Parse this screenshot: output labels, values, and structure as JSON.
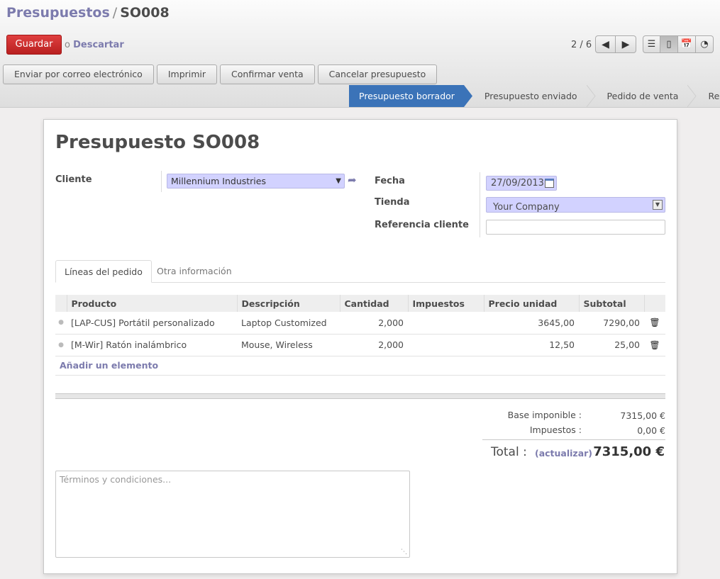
{
  "breadcrumb": {
    "parent": "Presupuestos",
    "separator": "/",
    "current": "SO008"
  },
  "toolbar": {
    "save_label": "Guardar",
    "or_label": "o",
    "discard_label": "Descartar"
  },
  "pager": {
    "text": "2 / 6",
    "prev_icon": "arrow-left-icon",
    "next_icon": "arrow-right-icon"
  },
  "view_switcher": [
    "list-view-icon",
    "form-view-icon",
    "calendar-view-icon",
    "graph-view-icon"
  ],
  "actions": [
    "Enviar por correo electrónico",
    "Imprimir",
    "Confirmar venta",
    "Cancelar presupuesto"
  ],
  "statusbar": {
    "stages": [
      "Presupuesto borrador",
      "Presupuesto enviado",
      "Pedido de venta",
      "Realizado"
    ],
    "active_index": 0,
    "active_color": "#3b73b8"
  },
  "form": {
    "title": "Presupuesto SO008",
    "customer_label": "Cliente",
    "customer_value": "Millennium Industries",
    "date_label": "Fecha",
    "date_value": "27/09/2013",
    "shop_label": "Tienda",
    "shop_value": "Your Company",
    "client_ref_label": "Referencia cliente",
    "client_ref_value": ""
  },
  "tabs": [
    "Líneas del pedido",
    "Otra información"
  ],
  "order_lines": {
    "columns": [
      "Producto",
      "Descripción",
      "Cantidad",
      "Impuestos",
      "Precio unidad",
      "Subtotal"
    ],
    "rows": [
      {
        "product": "[LAP-CUS] Portátil personalizado",
        "description": "Laptop Customized",
        "qty": "2,000",
        "taxes": "",
        "price": "3645,00",
        "subtotal": "7290,00"
      },
      {
        "product": "[M-Wir] Ratón inalámbrico",
        "description": "Mouse, Wireless",
        "qty": "2,000",
        "taxes": "",
        "price": "12,50",
        "subtotal": "25,00"
      }
    ],
    "add_label": "Añadir un elemento"
  },
  "totals": {
    "base_label": "Base imponible :",
    "base_value": "7315,00 €",
    "tax_label": "Impuestos :",
    "tax_value": "0,00 €",
    "total_label": "Total :",
    "update_label": "(actualizar)",
    "total_value": "7315,00 €"
  },
  "terms_placeholder": "Términos y condiciones..."
}
